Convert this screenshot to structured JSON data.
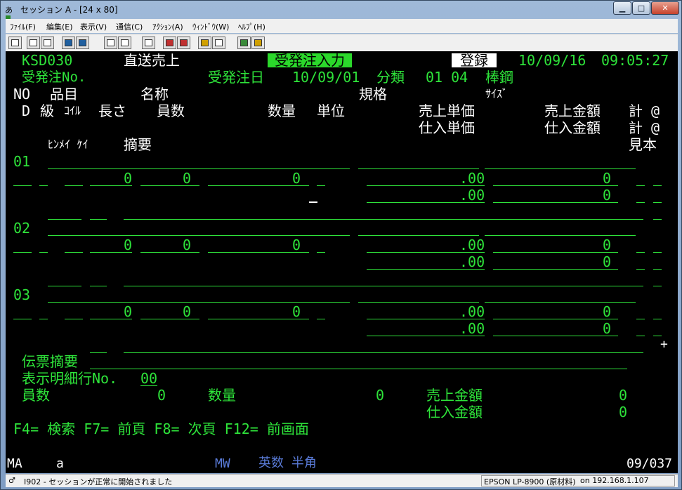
{
  "window": {
    "title": "セッション A - [24 x 80]",
    "minimize": "▁",
    "maximize": "□",
    "close": "✕"
  },
  "menu": [
    "ﾌｧｲﾙ(F)",
    "編集(E)",
    "表示(V)",
    "通信(C)",
    "ｱｸｼｮﾝ(A)",
    "ｳｨﾝﾄﾞｳ(W)",
    "ﾍﾙﾌﾟ(H)"
  ],
  "screen": {
    "program_id": "KSD030",
    "screen_title": "直送売上",
    "mode_label": "受発注入力",
    "action_label": "登録",
    "date": "10/09/16",
    "time": "09:05:27",
    "order_no_label": "受発注No.",
    "order_date_label": "受発注日",
    "order_date": "10/09/01",
    "category_label": "分類",
    "category_code": "01 04",
    "category_name": "棒鋼",
    "hdr": {
      "no": "NO",
      "item": "品目",
      "name": "名称",
      "spec": "規格",
      "size": "ｻｲｽﾞ",
      "d": "D",
      "grade": "級",
      "coil": "ｺｲﾙ",
      "length": "長さ",
      "count": "員数",
      "qty": "数量",
      "unit": "単位",
      "sale_price": "売上単価",
      "sale_amount": "売上金額",
      "purchase_price": "仕入単価",
      "purchase_amount": "仕入金額",
      "calc1": "計 @",
      "calc2": "計 @",
      "hinmei_kei": "ﾋﾝﾒｲ ｹｲ",
      "summary": "摘要",
      "sample": "見本"
    },
    "rows": [
      {
        "no": "01",
        "count_a": "0",
        "count_b": "0",
        "qty": "0",
        "sale_price": ".00",
        "sale_amount": "0",
        "purchase_price": ".00",
        "purchase_amount": "0"
      },
      {
        "no": "02",
        "count_a": "0",
        "count_b": "0",
        "qty": "0",
        "sale_price": ".00",
        "sale_amount": "0",
        "purchase_price": ".00",
        "purchase_amount": "0"
      },
      {
        "no": "03",
        "count_a": "0",
        "count_b": "0",
        "qty": "0",
        "sale_price": ".00",
        "sale_amount": "0",
        "purchase_price": ".00",
        "purchase_amount": "0"
      }
    ],
    "plus": "+",
    "voucher_summary_label": "伝票摘要",
    "detail_row_label": "表示明細行No.",
    "detail_row_value": "00",
    "total_count_label": "員数",
    "total_count": "0",
    "total_qty_label": "数量",
    "total_qty": "0",
    "total_sale_label": "売上金額",
    "total_sale": "0",
    "total_purchase_label": "仕入金額",
    "total_purchase": "0",
    "fkeys": "F4= 検索 F7= 前頁 F8= 次頁 F12= 前画面"
  },
  "oia": {
    "ma": "MA",
    "a": "a",
    "mw": "MW",
    "input_mode": "英数 半角",
    "cursor_pos": "09/037"
  },
  "status": {
    "message": "I902 - セッションが正常に開始されました",
    "printer": "EPSON LP-8900 (原材料)",
    "host": "on 192.168.1.107"
  }
}
